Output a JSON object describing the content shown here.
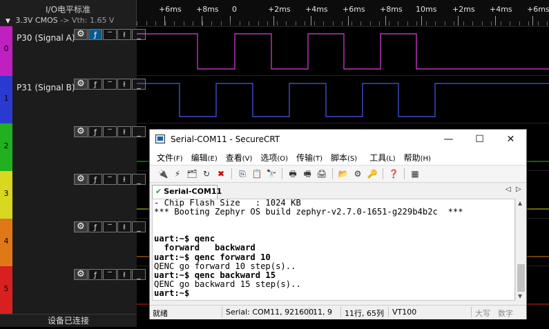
{
  "analyzer": {
    "panel_title": "I/O电平标准",
    "voltage_standard": "3.3V CMOS",
    "vth_label": "-> Vth: 1.65 V",
    "status": "设备已连接",
    "timeline": {
      "ticks": [
        {
          "label": "+6ms"
        },
        {
          "label": "+8ms"
        },
        {
          "label": "0"
        },
        {
          "label": "+2ms"
        },
        {
          "label": "+4ms"
        },
        {
          "label": "+6ms"
        },
        {
          "label": "+8ms"
        },
        {
          "label": "10ms"
        },
        {
          "label": "+2ms"
        },
        {
          "label": "+4ms"
        },
        {
          "label": "+6ms"
        }
      ]
    },
    "channels": [
      {
        "number": "0",
        "name": "P30 (Signal A)",
        "color": "#c020c0",
        "trace_color": "#e040e0"
      },
      {
        "number": "1",
        "name": "P31 (Signal B)",
        "color": "#2a3ad0",
        "trace_color": "#4a5af0"
      },
      {
        "number": "2",
        "name": "",
        "color": "#20b020",
        "trace_color": "#20c020"
      },
      {
        "number": "3",
        "name": "",
        "color": "#d8d820",
        "trace_color": "#d8d820"
      },
      {
        "number": "4",
        "name": "",
        "color": "#e07818",
        "trace_color": "#e07818"
      },
      {
        "number": "5",
        "name": "",
        "color": "#d82020",
        "trace_color": "#d82020"
      }
    ],
    "tool_icons": [
      "gear-icon",
      "any-edge-icon",
      "high-level-icon",
      "falling-edge-icon",
      "low-level-icon"
    ],
    "tool_glyphs": {
      "gear": "⚙",
      "edge": "ƒ",
      "high": "‾",
      "fall": "ł",
      "low": "_"
    }
  },
  "crt": {
    "window_title": "Serial-COM11 - SecureCRT",
    "menu": [
      {
        "label": "文件",
        "accel": "(F)"
      },
      {
        "label": "编辑",
        "accel": "(E)"
      },
      {
        "label": "查看",
        "accel": "(V)"
      },
      {
        "label": "选项",
        "accel": "(O)"
      },
      {
        "label": "传输",
        "accel": "(T)"
      },
      {
        "label": "脚本",
        "accel": "(S)"
      },
      {
        "label": "工具",
        "accel": "(L)"
      },
      {
        "label": "帮助",
        "accel": "(H)"
      }
    ],
    "tab_label": "Serial-COM11",
    "terminal_lines": [
      {
        "text": "- Chip Flash Size   : 1024 KB",
        "bold": false
      },
      {
        "text": "*** Booting Zephyr OS build zephyr-v2.7.0-1651-g229b4b2c  ***",
        "bold": false
      },
      {
        "text": "",
        "bold": false
      },
      {
        "text": "",
        "bold": false
      },
      {
        "text": "uart:~$ qenc",
        "bold": true
      },
      {
        "text": "  forward   backward",
        "bold": true
      },
      {
        "text": "uart:~$ qenc forward 10",
        "bold": true
      },
      {
        "text": "QENC go forward 10 step(s)..",
        "bold": false
      },
      {
        "text": "uart:~$ qenc backward 15",
        "bold": true
      },
      {
        "text": "QENC go backward 15 step(s)..",
        "bold": false
      },
      {
        "text": "uart:~$ ",
        "bold": true
      }
    ],
    "status": {
      "ready": "就绪",
      "connection": "Serial: COM11, 921600",
      "cursor": "11,  9",
      "rowcol": "11行, 65列",
      "emulation": "VT100",
      "caps": "大写",
      "num": "数字"
    }
  }
}
